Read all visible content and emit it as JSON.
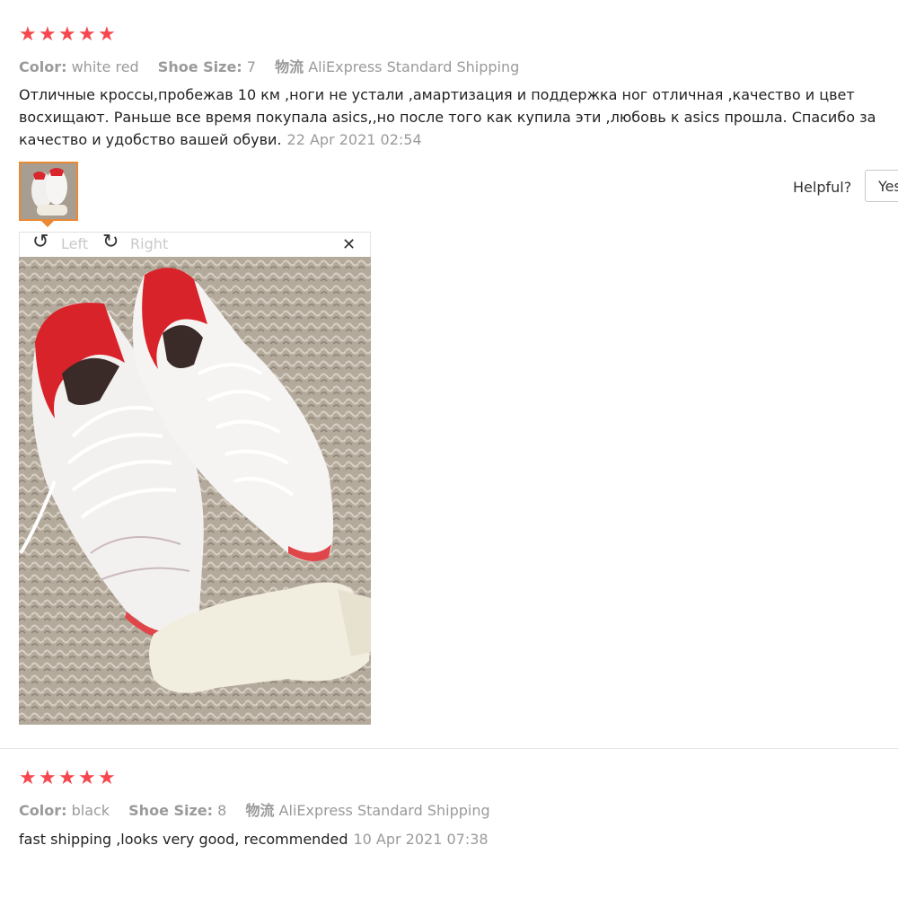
{
  "reviews": [
    {
      "rating": 5,
      "color_label": "Color:",
      "color_value": "white red",
      "size_label": "Shoe Size:",
      "size_value": "7",
      "shipping_label": "物流",
      "shipping_value": "AliExpress Standard Shipping",
      "text_lines": [
        "Отличные кроссы,пробежав 10 км ,ноги не устали ,амартизация и поддержка ног отличная ,качество и цвет",
        "восхищают. Раньше все время покупала asics,,но после того как купила эти ,любовь к asics прошла. Спасибо за",
        "качество и удобство вашей обуви."
      ],
      "date": "22 Apr 2021 02:54",
      "helpful_label": "Helpful?",
      "yes_label": "Yes",
      "viewer": {
        "rotate_left_label": "Left",
        "rotate_right_label": "Right",
        "close_glyph": "✕",
        "rotate_left_glyph": "↺",
        "rotate_right_glyph": "↻"
      }
    },
    {
      "rating": 5,
      "color_label": "Color:",
      "color_value": "black",
      "size_label": "Shoe Size:",
      "size_value": "8",
      "shipping_label": "物流",
      "shipping_value": "AliExpress Standard Shipping",
      "text": "fast shipping ,looks very good, recommended",
      "date": "10 Apr 2021 07:38"
    }
  ],
  "colors": {
    "star": "#f5474d",
    "meta_gray": "#9a9a9a",
    "thumb_border": "#e88934"
  },
  "star_glyph": "★"
}
